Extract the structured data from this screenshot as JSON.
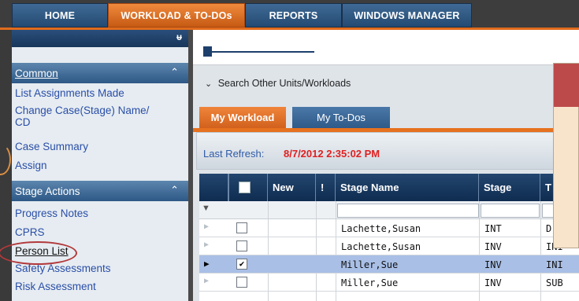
{
  "nav": {
    "tabs": [
      {
        "label": "HOME",
        "active": false
      },
      {
        "label": "WORKLOAD & TO-DOs",
        "active": true
      },
      {
        "label": "REPORTS",
        "active": false
      },
      {
        "label": "WINDOWS MANAGER",
        "active": false
      }
    ]
  },
  "sidebar": {
    "pin_icon": "pin-icon",
    "common": {
      "title": "Common",
      "links": [
        "List Assignments Made",
        "Change Case(Stage) Name/",
        "CD",
        "Case Summary",
        "Assign"
      ]
    },
    "stage_actions": {
      "title": "Stage Actions",
      "links": [
        "Progress Notes",
        "CPRS",
        "Person List",
        "Safety Assessments",
        "Risk Assessment"
      ]
    }
  },
  "main": {
    "search_label": "Search Other Units/Workloads",
    "tabs": [
      {
        "label": "My Workload",
        "active": true
      },
      {
        "label": "My To-Dos",
        "active": false
      }
    ],
    "refresh_label": "Last Refresh:",
    "refresh_value": "8/7/2012 2:35:02 PM",
    "grid": {
      "columns": [
        "New",
        "!",
        "Stage Name",
        "Stage",
        "T"
      ],
      "rows": [
        {
          "name": "Lachette,Susan",
          "stage": "INT",
          "t": "D",
          "checked": false,
          "selected": false
        },
        {
          "name": "Lachette,Susan",
          "stage": "INV",
          "t": "INI",
          "checked": false,
          "selected": false
        },
        {
          "name": "Miller,Sue",
          "stage": "INV",
          "t": "INI",
          "checked": true,
          "selected": true
        },
        {
          "name": "Miller,Sue",
          "stage": "INV",
          "t": "SUB",
          "checked": false,
          "selected": false
        }
      ]
    }
  },
  "colors": {
    "accent_orange": "#e06b1c",
    "nav_blue": "#244a72",
    "link_blue": "#2a4ea8",
    "refresh_red": "#e02020",
    "annotation_red": "#b2383b"
  }
}
